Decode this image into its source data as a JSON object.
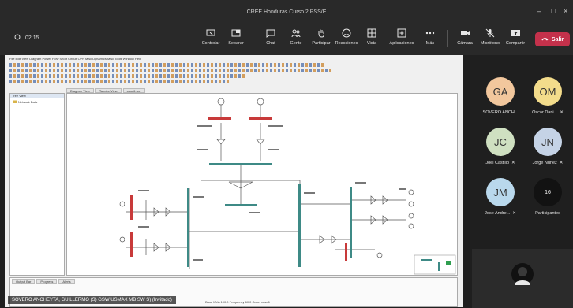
{
  "window": {
    "title": "CREE Honduras Curso 2 PSS/E"
  },
  "meeting": {
    "timer": "02:15",
    "controls": [
      {
        "key": "control",
        "label": "Controlar"
      },
      {
        "key": "separate",
        "label": "Separar"
      },
      {
        "key": "chat",
        "label": "Chat"
      },
      {
        "key": "people",
        "label": "Gente"
      },
      {
        "key": "raise",
        "label": "Participar"
      },
      {
        "key": "react",
        "label": "Reacciones"
      },
      {
        "key": "view",
        "label": "Vista"
      },
      {
        "key": "apps",
        "label": "Aplicaciones"
      },
      {
        "key": "more",
        "label": "Más"
      }
    ],
    "devices": [
      {
        "key": "camera",
        "label": "Cámara"
      },
      {
        "key": "mic",
        "label": "Micrófono"
      },
      {
        "key": "share",
        "label": "Compartir"
      }
    ],
    "leave_label": "Salir",
    "presenter_name": "SOVERO ANCHEYTA, GUILLERMO (S) GSW USMAX MB SW S) (Invitado)"
  },
  "participants": [
    {
      "initials": "GA",
      "name": "SOVERO ANCH...",
      "color": "#f2c79d",
      "muted": false
    },
    {
      "initials": "OM",
      "name": "Oscar Dani...",
      "color": "#f3dc8b",
      "muted": true
    },
    {
      "initials": "JC",
      "name": "Joel Castillo",
      "color": "#cfe0c1",
      "muted": true
    },
    {
      "initials": "JN",
      "name": "Jorge Núñez",
      "color": "#c5d3e6",
      "muted": true
    },
    {
      "initials": "JM",
      "name": "Jose Andre...",
      "color": "#b9d8ec",
      "muted": true
    },
    {
      "initials": "16",
      "name": "Participantes",
      "color": "#121212",
      "muted": false
    }
  ],
  "shared_app": {
    "menu_text": "File  Edit  View  Diagram  Power Flow  Short Circuit  OPF  Misc  Dynamics  Misc  Tools  Window  Help",
    "tree_header": "Tree View",
    "tree_root": "Network Data",
    "doc_tabs": [
      "Diagram View",
      "Tabular View",
      "caso6.sav"
    ],
    "bottom_tabs": [
      "Output Bar",
      "Progress",
      "Alerts"
    ],
    "status_text": "Base MVA  100.0   Frequency  60.0   Case: caso6"
  }
}
